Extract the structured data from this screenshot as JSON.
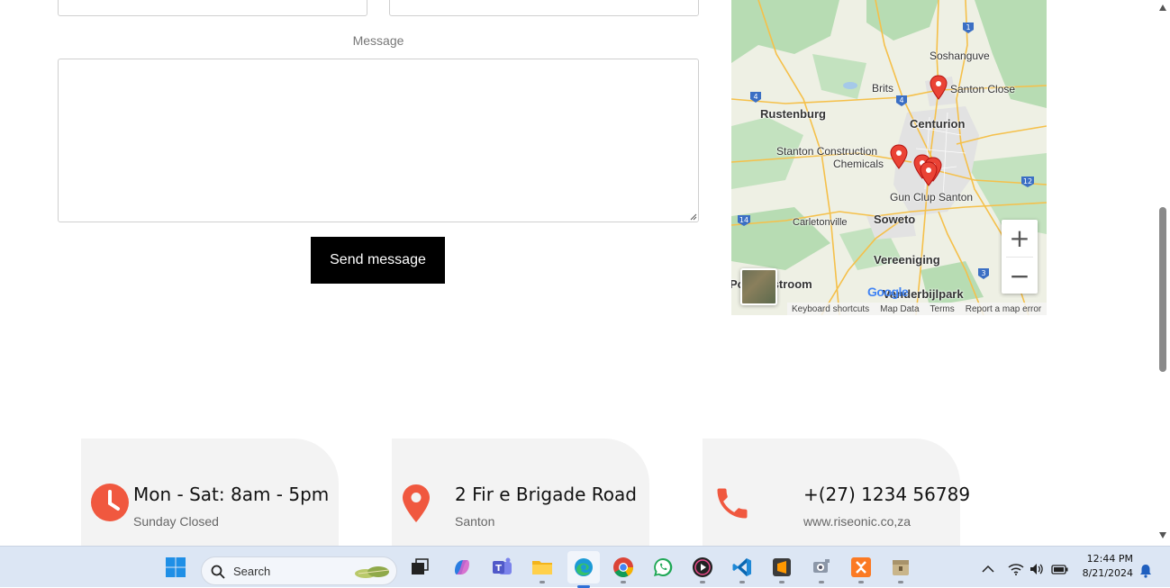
{
  "form": {
    "message_label": "Message",
    "message_value": "",
    "send_label": "Send message"
  },
  "map": {
    "labels": {
      "soshanguve": "Soshanguve",
      "brits": "Brits",
      "santon_close": "Santon Close",
      "rustenburg": "Rustenburg",
      "centurion": "Centurion",
      "stanton_construction": "Stanton Construction",
      "chemicals": "Chemicals",
      "gun_club_santon": "Gun Clup Santon",
      "carletonville": "Carletonville",
      "soweto": "Soweto",
      "vereeniging": "Vereeniging",
      "potchefstroom": "Potchefstroom",
      "vanderbijlpark": "Vanderbijlpark"
    },
    "route_shields": [
      "1",
      "4",
      "4",
      "12",
      "14",
      "3"
    ],
    "zoom_in": "+",
    "zoom_out": "−",
    "google": "Google",
    "attribution": {
      "keyboard": "Keyboard shortcuts",
      "map_data": "Map Data",
      "terms": "Terms",
      "report": "Report a map error"
    }
  },
  "cards": [
    {
      "icon": "clock-icon",
      "title": "Mon - Sat: 8am - 5pm",
      "sub": "Sunday Closed"
    },
    {
      "icon": "location-pin-icon",
      "title": "2 Fir e Brigade Road",
      "sub": "Santon"
    },
    {
      "icon": "phone-icon",
      "title": "+(27) 1234 56789",
      "sub": "www.riseonic.co,za"
    }
  ],
  "colors": {
    "accent": "#f0583f",
    "button_bg": "#000000",
    "card_bg": "#f3f3f3",
    "taskbar_bg": "#dce6f4"
  },
  "taskbar": {
    "search_placeholder": "Search",
    "apps": [
      "start-icon",
      "task-view-icon",
      "copilot-icon",
      "teams-icon",
      "file-explorer-icon",
      "edge-icon",
      "chrome-icon",
      "whatsapp-icon",
      "media-player-icon",
      "vscode-icon",
      "sublime-text-icon",
      "app-icon",
      "xampp-icon",
      "archive-icon"
    ],
    "time": "12:44 PM",
    "date": "8/21/2024"
  }
}
